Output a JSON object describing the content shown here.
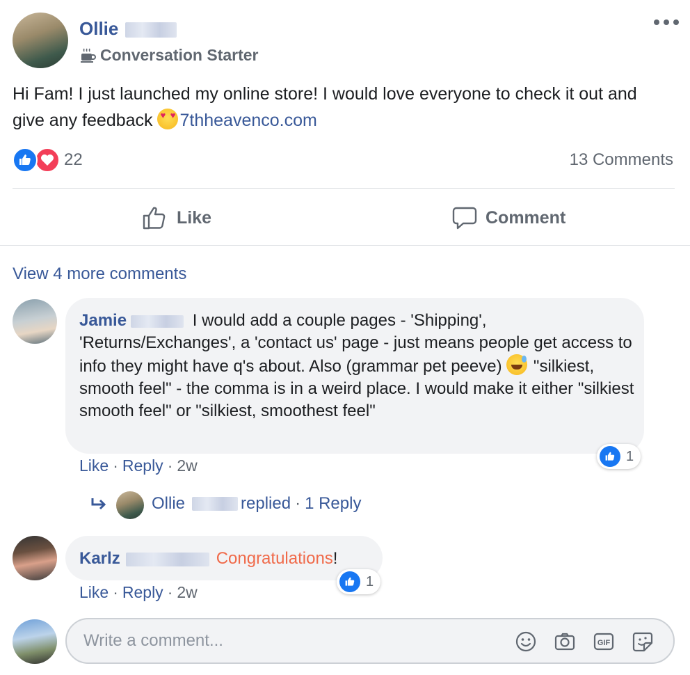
{
  "post": {
    "author": {
      "name": "Ollie",
      "badge": "Conversation Starter"
    },
    "text_before_link": "Hi Fam! I just launched my online store! I would love everyone to check it out and give any feedback ",
    "link": "7thheavenco.com",
    "reactions": {
      "count": "22",
      "types": [
        "like-icon",
        "love-icon"
      ]
    },
    "comments_count": "13 Comments"
  },
  "actions": {
    "like": "Like",
    "comment": "Comment"
  },
  "view_more": "View 4 more comments",
  "comments": [
    {
      "name": "Jamie",
      "text_part1": " I would add a couple pages - 'Shipping', 'Returns/Exchanges', a 'contact us' page - just means people get access to info they might have q's about. Also (grammar pet peeve) ",
      "text_part2": " \"silkiest, smooth feel\" - the comma is in a weird place. I would make it either \"silkiest smooth feel\" or \"silkiest, smoothest feel\"",
      "like_count": "1",
      "actions": {
        "like": "Like",
        "reply": "Reply",
        "time": "2w",
        "sep": "·"
      },
      "reply_summary": {
        "name": "Ollie",
        "replied": "replied",
        "sep": "·",
        "count": "1 Reply"
      }
    },
    {
      "name": "Karlz",
      "text_highlight": "Congratulations",
      "text_end": "!",
      "like_count": "1",
      "actions": {
        "like": "Like",
        "reply": "Reply",
        "time": "2w",
        "sep": "·"
      }
    }
  ],
  "composer": {
    "placeholder": "Write a comment...",
    "icons": [
      "emoji-icon",
      "camera-icon",
      "gif-icon",
      "sticker-icon"
    ]
  },
  "colors": {
    "link_blue": "#385898",
    "like_blue": "#1877f2",
    "love_red": "#f33e58",
    "highlight": "#f06a4a",
    "bubble": "#f2f3f5"
  }
}
